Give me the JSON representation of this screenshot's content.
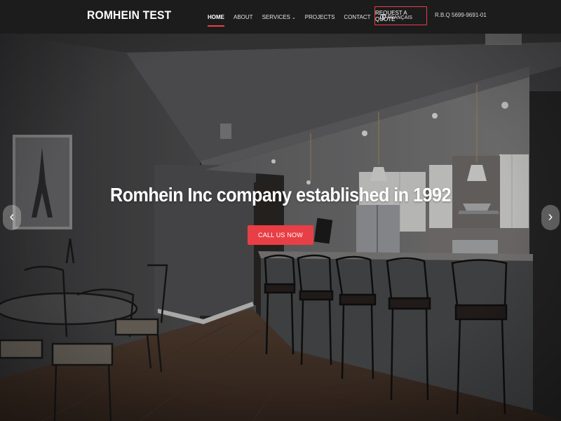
{
  "header": {
    "logo": "ROMHEIN TEST",
    "nav": {
      "home": "HOME",
      "about": "ABOUT",
      "services": "SERVICES",
      "projects": "PROJECTS",
      "contact": "CONTACT",
      "language": "FRANÇAIS"
    },
    "quote_button": "REQUEST A QUOTE",
    "license": "R.B.Q 5699-9691-01"
  },
  "hero": {
    "title": "Romhein Inc company established in 1992",
    "cta": "CALL US NOW"
  },
  "colors": {
    "accent": "#e83e45",
    "header_bg": "#1c1c1c",
    "wall": "#5a5a5c"
  },
  "icons": {
    "services_dropdown": "chevron-down-icon",
    "language": "globe-icon",
    "slider_prev": "chevron-left-icon",
    "slider_next": "chevron-right-icon"
  }
}
